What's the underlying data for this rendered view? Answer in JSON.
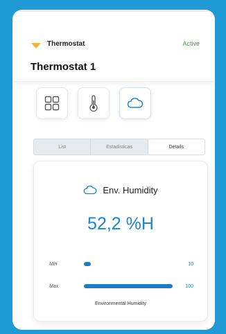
{
  "header": {
    "device_name": "Thermostat",
    "status": "Active",
    "title": "Thermostat 1"
  },
  "tiles": [
    {
      "icon": "grid-icon"
    },
    {
      "icon": "thermometer-icon"
    },
    {
      "icon": "cloud-icon"
    }
  ],
  "tabs": [
    "List",
    "Estadísticas",
    "Details"
  ],
  "selected_tab": "Details",
  "card": {
    "title": "Env. Humidity",
    "value": "52,2 %H",
    "min_label": "Min",
    "min_value": "10",
    "max_label": "Max",
    "max_value": "100",
    "caption": "Environmental Humidity"
  },
  "colors": {
    "background": "#1f9ad6",
    "accent": "#1a86cf",
    "status": "#3aa64a",
    "device_icon": "#f2b63c"
  }
}
